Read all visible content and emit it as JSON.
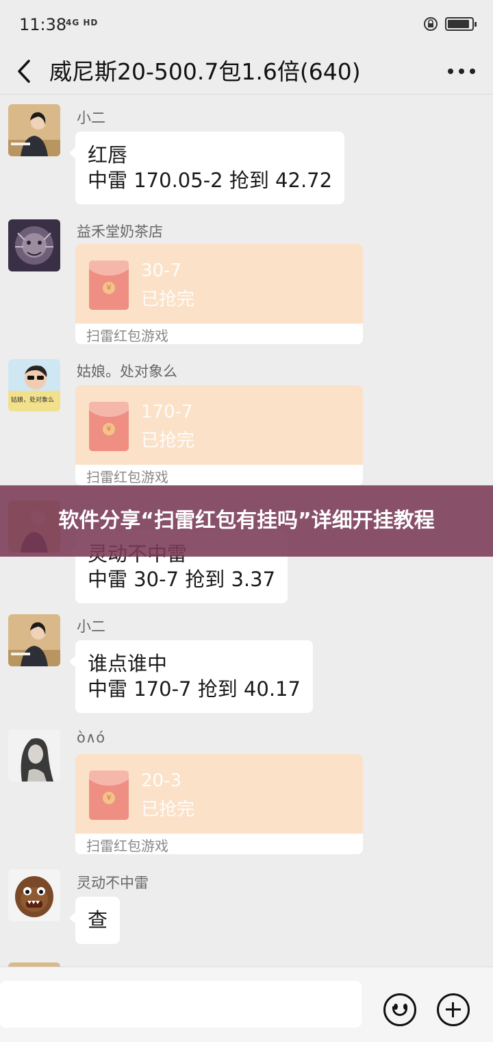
{
  "status_bar": {
    "time": "11:38",
    "network": "4G HD",
    "battery_level_percent": 90
  },
  "title_bar": {
    "title": "威尼斯20-500.7包1.6倍(640)"
  },
  "messages": [
    {
      "sender": "小二",
      "type": "text",
      "lines": [
        "红唇",
        "中雷 170.05-2 抢到 42.72"
      ]
    },
    {
      "sender": "益禾堂奶茶店",
      "type": "red_packet",
      "amount": "30-7",
      "status": "已抢完",
      "label": "扫雷红包游戏"
    },
    {
      "sender": "姑娘。处对象么",
      "type": "red_packet",
      "amount": "170-7",
      "status": "已抢完",
      "label": "扫雷红包游戏"
    },
    {
      "sender": "",
      "type": "text",
      "lines": [
        "灵动不中雷",
        "中雷 30-7 抢到 3.37"
      ]
    },
    {
      "sender": "小二",
      "type": "text",
      "lines": [
        "谁点谁中",
        "中雷 170-7 抢到 40.17"
      ]
    },
    {
      "sender": "ò∧ó",
      "type": "red_packet",
      "amount": "20-3",
      "status": "已抢完",
      "label": "扫雷红包游戏"
    },
    {
      "sender": "灵动不中雷",
      "type": "text",
      "lines": [
        "查"
      ]
    }
  ],
  "avatar_captions": {
    "girl": "姑娘，处对象么"
  },
  "banner": {
    "text": "软件分享“扫雷红包有挂吗”详细开挂教程"
  },
  "input_bar": {
    "value": ""
  },
  "colors": {
    "background": "#ededed",
    "bubble": "#ffffff",
    "red_packet_opened": "#fbe1c8",
    "banner": "#7a3a56"
  }
}
